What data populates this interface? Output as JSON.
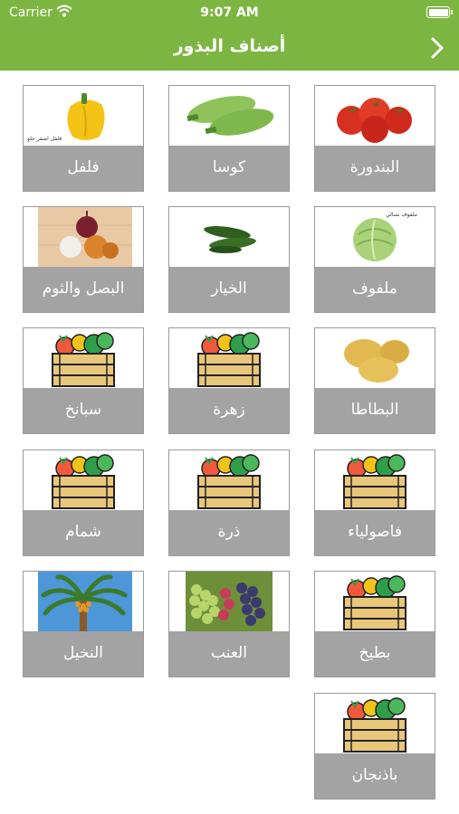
{
  "status_bar": {
    "carrier": "Carrier",
    "time": "9:07 AM"
  },
  "header": {
    "title": "أصناف البذور",
    "back_icon": "chevron-right-icon"
  },
  "colors": {
    "accent": "#7db542",
    "label_bg": "#a3a3a3"
  },
  "cards": [
    {
      "label": "البندورة",
      "image": "tomato-icon"
    },
    {
      "label": "كوسا",
      "image": "zucchini-icon"
    },
    {
      "label": "فلفل",
      "image": "pepper-icon",
      "image_caption": "فلفل اصفر حلو"
    },
    {
      "label": "ملفوف",
      "image": "cabbage-icon",
      "image_caption": "ملفوف نصالي"
    },
    {
      "label": "الخيار",
      "image": "cucumber-icon"
    },
    {
      "label": "البصل والثوم",
      "image": "onion-garlic-icon"
    },
    {
      "label": "البطاطا",
      "image": "potato-icon"
    },
    {
      "label": "زهرة",
      "image": "vegetable-crate-icon"
    },
    {
      "label": "سبانخ",
      "image": "vegetable-crate-icon"
    },
    {
      "label": "فاصولياء",
      "image": "vegetable-crate-icon"
    },
    {
      "label": "ذرة",
      "image": "vegetable-crate-icon"
    },
    {
      "label": "شمام",
      "image": "vegetable-crate-icon"
    },
    {
      "label": "بطيخ",
      "image": "vegetable-crate-icon"
    },
    {
      "label": "العنب",
      "image": "grapes-icon"
    },
    {
      "label": "النخيل",
      "image": "palm-tree-icon"
    },
    {
      "label": "باذنجان",
      "image": "vegetable-crate-icon"
    }
  ]
}
